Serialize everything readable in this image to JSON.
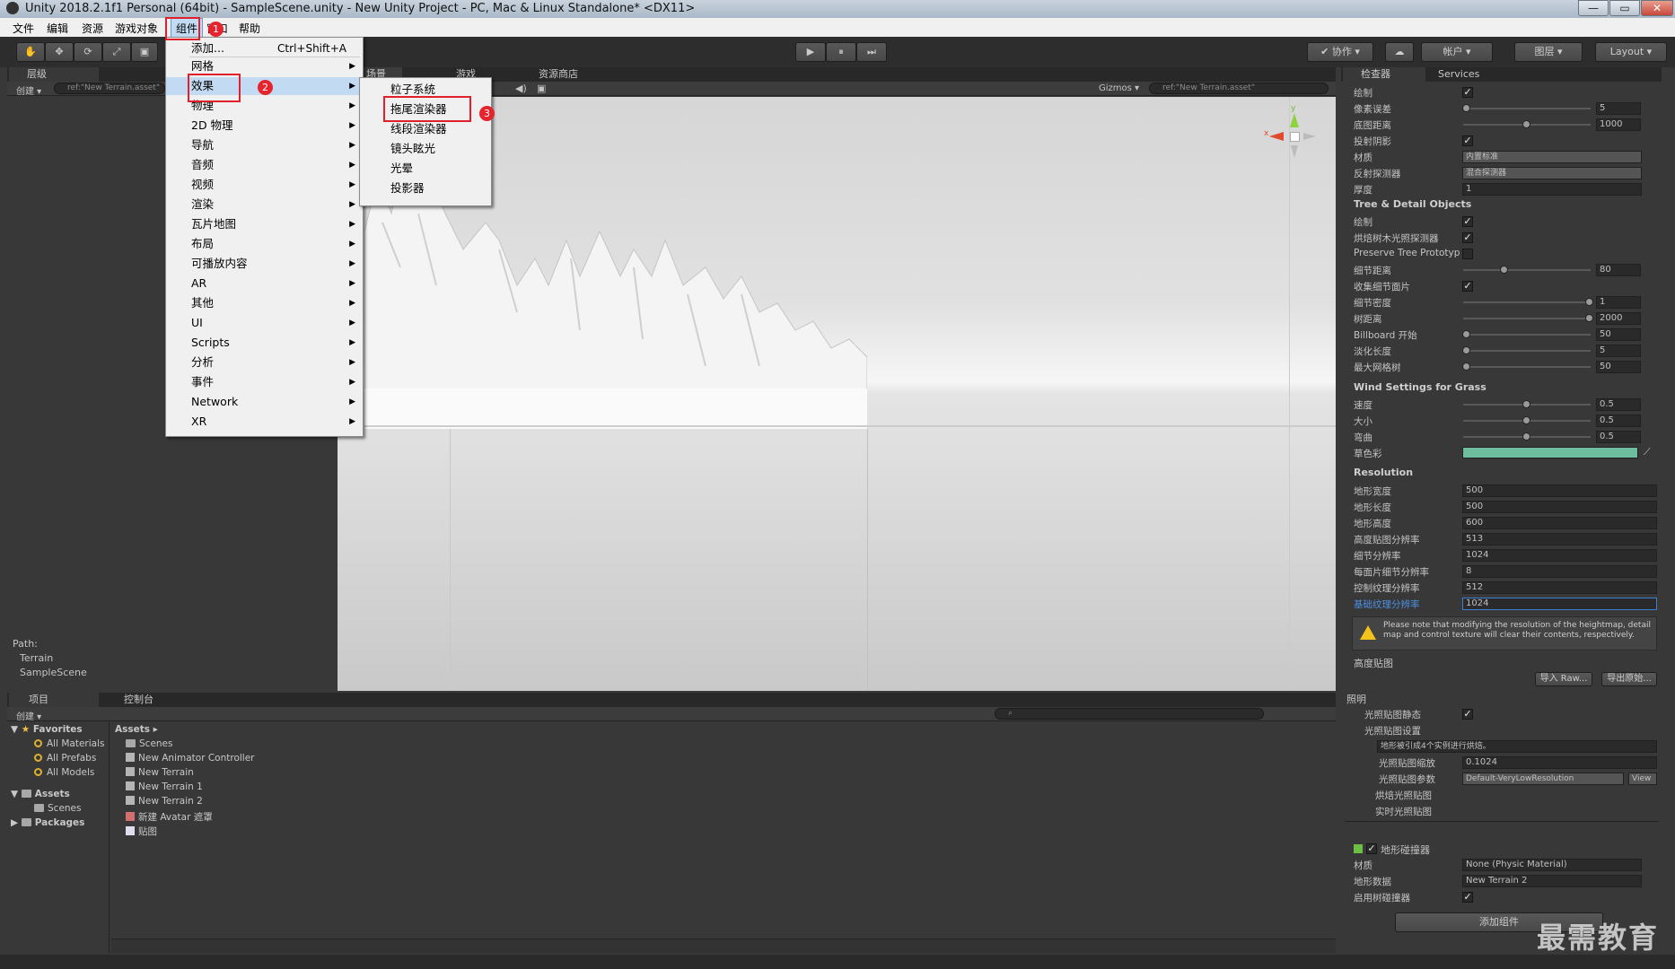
{
  "window": {
    "title": "Unity 2018.2.1f1 Personal (64bit) - SampleScene.unity - New Unity Project - PC, Mac & Linux Standalone* <DX11>",
    "min": "—",
    "max": "▭",
    "close": "✕"
  },
  "menubar": {
    "items": [
      "文件",
      "编辑",
      "资源",
      "游戏对象",
      "组件",
      "窗口",
      "帮助"
    ],
    "hidden_item": "窗"
  },
  "toolbar": {
    "collab": "✔ 协作 ▾",
    "account": "帐户 ▾",
    "layers": "图层 ▾",
    "layout": "Layout ▾",
    "play": "▶",
    "pause": "⏸",
    "step": "⏭"
  },
  "hierarchy": {
    "tab": "层级",
    "create": "创建 ▾",
    "search": "ref:\"New Terrain.asset\"",
    "path_label": "Path:",
    "path": [
      "Terrain",
      "SampleScene"
    ]
  },
  "scene": {
    "tabs": [
      "场景",
      "游戏",
      "资源商店"
    ],
    "gizmos": "Gizmos ▾",
    "search": "ref:\"New Terrain.asset\"",
    "axis_y": "y",
    "axis_x": "x"
  },
  "component_menu": {
    "items": [
      {
        "label": "添加...",
        "shortcut": "Ctrl+Shift+A",
        "submenu": false
      },
      {
        "label": "网格",
        "submenu": true
      },
      {
        "label": "效果",
        "submenu": true,
        "highlighted": true
      },
      {
        "label": "物理",
        "submenu": true
      },
      {
        "label": "2D 物理",
        "submenu": true
      },
      {
        "label": "导航",
        "submenu": true
      },
      {
        "label": "音频",
        "submenu": true
      },
      {
        "label": "视频",
        "submenu": true
      },
      {
        "label": "渲染",
        "submenu": true
      },
      {
        "label": "瓦片地图",
        "submenu": true
      },
      {
        "label": "布局",
        "submenu": true
      },
      {
        "label": "可播放内容",
        "submenu": true
      },
      {
        "label": "AR",
        "submenu": true
      },
      {
        "label": "其他",
        "submenu": true
      },
      {
        "label": "UI",
        "submenu": true
      },
      {
        "label": "Scripts",
        "submenu": true
      },
      {
        "label": "分析",
        "submenu": true
      },
      {
        "label": "事件",
        "submenu": true
      },
      {
        "label": "Network",
        "submenu": true
      },
      {
        "label": "XR",
        "submenu": true
      }
    ]
  },
  "effects_menu": {
    "items": [
      "粒子系统",
      "拖尾渲染器",
      "线段渲染器",
      "镜头眩光",
      "光晕",
      "投影器"
    ]
  },
  "badges": [
    "1",
    "2",
    "3"
  ],
  "project": {
    "tabs": [
      "项目",
      "控制台"
    ],
    "create": "创建 ▾",
    "favorites": {
      "label": "Favorites",
      "items": [
        "All Materials",
        "All Prefabs",
        "All Models"
      ]
    },
    "assets_tree": {
      "label": "Assets",
      "children": [
        "Scenes"
      ]
    },
    "packages": "Packages",
    "breadcrumb": "Assets ▸",
    "assets": [
      "Scenes",
      "New Animator Controller",
      "New Terrain",
      "New Terrain 1",
      "New Terrain 2",
      "新建 Avatar 遮罩",
      "贴图"
    ]
  },
  "inspector": {
    "tabs": [
      "检查器",
      "Services"
    ],
    "rows1": [
      {
        "label": "绘制",
        "type": "check"
      },
      {
        "label": "像素误差",
        "type": "slider",
        "value": "5",
        "pos": 0.02
      },
      {
        "label": "底图距离",
        "type": "slider",
        "value": "1000",
        "pos": 0.5
      },
      {
        "label": "投射阴影",
        "type": "check"
      },
      {
        "label": "材质",
        "type": "dropdown",
        "value": "内置标准"
      },
      {
        "label": "反射探测器",
        "type": "dropdown",
        "value": "混合探测器"
      },
      {
        "label": "厚度",
        "type": "text",
        "value": "1"
      }
    ],
    "tree_title": "Tree & Detail Objects",
    "rows2": [
      {
        "label": "绘制",
        "type": "check"
      },
      {
        "label": "烘焙树木光照探测器",
        "type": "check"
      },
      {
        "label": "Preserve Tree Prototyp",
        "type": "empty"
      },
      {
        "label": "细节距离",
        "type": "slider",
        "value": "80",
        "pos": 0.32
      },
      {
        "label": "收集细节面片",
        "type": "check"
      },
      {
        "label": "细节密度",
        "type": "slider",
        "value": "1",
        "pos": 1
      },
      {
        "label": "树距离",
        "type": "slider",
        "value": "2000",
        "pos": 1
      },
      {
        "label": "Billboard 开始",
        "type": "slider",
        "value": "50",
        "pos": 0.02
      },
      {
        "label": "淡化长度",
        "type": "slider",
        "value": "5",
        "pos": 0.02
      },
      {
        "label": "最大网格树",
        "type": "slider",
        "value": "50",
        "pos": 0.02
      }
    ],
    "wind_title": "Wind Settings for Grass",
    "rows3": [
      {
        "label": "速度",
        "type": "slider",
        "value": "0.5",
        "pos": 0.5
      },
      {
        "label": "大小",
        "type": "slider",
        "value": "0.5",
        "pos": 0.5
      },
      {
        "label": "弯曲",
        "type": "slider",
        "value": "0.5",
        "pos": 0.5
      },
      {
        "label": "草色彩",
        "type": "color"
      }
    ],
    "res_title": "Resolution",
    "rows4": [
      {
        "label": "地形宽度",
        "value": "500"
      },
      {
        "label": "地形长度",
        "value": "500"
      },
      {
        "label": "地形高度",
        "value": "600"
      },
      {
        "label": "高度贴图分辨率",
        "value": "513"
      },
      {
        "label": "细节分辨率",
        "value": "1024"
      },
      {
        "label": "每面片细节分辨率",
        "value": "8"
      },
      {
        "label": "控制纹理分辨率",
        "value": "512"
      },
      {
        "label": "基础纹理分辨率",
        "value": "1024",
        "active": true
      }
    ],
    "warning": "Please note that modifying the resolution of the heightmap, detail map and control texture will clear their contents, respectively.",
    "heightmap_label": "高度贴图",
    "import_raw": "导入 Raw...",
    "export_raw": "导出原始...",
    "lighting": {
      "title": "照明",
      "static_label": "光照贴图静态",
      "settings_label": "光照贴图设置",
      "info": "地形被引成4个实例进行烘焙。",
      "scale_label": "光照贴图缩放",
      "scale_value": "0.1024",
      "param_label": "光照贴图参数",
      "param_value": "Default-VeryLowResolution",
      "view": "View",
      "baked": "烘焙光照贴图",
      "realtime": "实时光照贴图"
    },
    "collider": {
      "title": "地形碰撞器",
      "material_label": "材质",
      "material_value": "None (Physic Material)",
      "data_label": "地形数据",
      "data_value": "New Terrain 2",
      "tree_label": "启用树碰撞器"
    },
    "add_component": "添加组件"
  },
  "watermark": "最需教育",
  "colors": {
    "grass": "#6dbd9e",
    "accent_red": "#e0202a",
    "active_label": "#4c8fe0"
  }
}
